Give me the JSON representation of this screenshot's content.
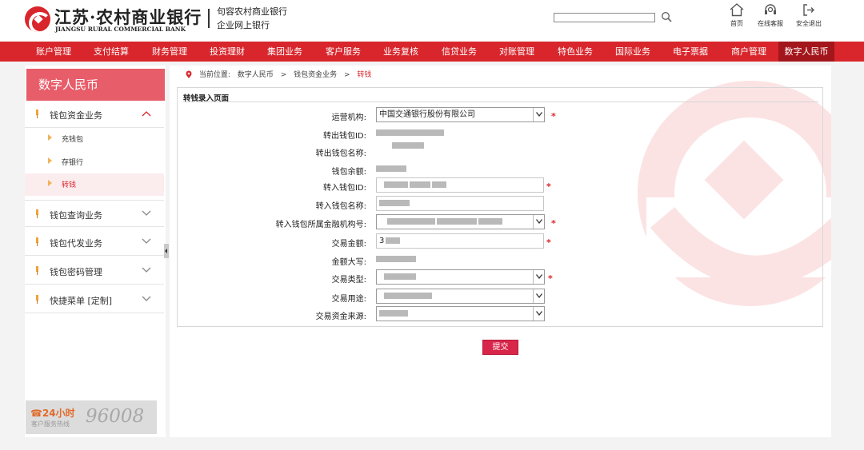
{
  "header": {
    "logo_cn": "江苏·农村商业银行",
    "logo_en": "JIANGSU RURAL COMMERCIAL BANK",
    "bank_name": "句容农村商业银行",
    "bank_sub": "企业网上银行",
    "search_placeholder": "",
    "links": [
      {
        "label": "首页",
        "icon": "home-icon"
      },
      {
        "label": "在线客服",
        "icon": "headset-icon"
      },
      {
        "label": "安全退出",
        "icon": "logout-icon"
      }
    ]
  },
  "nav": {
    "items": [
      "账户管理",
      "支付结算",
      "财务管理",
      "投资理财",
      "集团业务",
      "客户服务",
      "业务复核",
      "信贷业务",
      "对账管理",
      "特色业务",
      "国际业务",
      "电子票据",
      "商户管理",
      "数字人民币"
    ],
    "active_index": 13
  },
  "sidebar": {
    "title": "数字人民币",
    "groups": [
      {
        "label": "钱包资金业务",
        "expanded": true
      },
      {
        "label": "钱包查询业务",
        "expanded": false
      },
      {
        "label": "钱包代发业务",
        "expanded": false
      },
      {
        "label": "钱包密码管理",
        "expanded": false
      },
      {
        "label": "快捷菜单 [定制]",
        "expanded": false
      }
    ],
    "subitems": [
      {
        "label": "充钱包",
        "active": false
      },
      {
        "label": "存银行",
        "active": false
      },
      {
        "label": "转钱",
        "active": true
      }
    ],
    "hotline": {
      "label": "24小时",
      "sub": "客户服务热线",
      "number": "96008"
    }
  },
  "breadcrumb": {
    "prefix": "当前位置:",
    "items": [
      "数字人民币",
      "钱包资金业务"
    ],
    "current": "转钱"
  },
  "form": {
    "title": "转钱录入页面",
    "fields": {
      "org": {
        "label": "运营机构:",
        "value": "中国交通银行股份有限公司",
        "required": true
      },
      "out_id": {
        "label": "转出钱包ID:",
        "value": ""
      },
      "out_name": {
        "label": "转出钱包名称:",
        "value": ""
      },
      "balance": {
        "label": "钱包余额:",
        "value": ""
      },
      "in_id": {
        "label": "转入钱包ID:",
        "value": "",
        "required": true
      },
      "in_name": {
        "label": "转入钱包名称:",
        "value": ""
      },
      "in_org": {
        "label": "转入钱包所属金融机构号:",
        "value": "",
        "required": true
      },
      "amount": {
        "label": "交易金额:",
        "value": "3",
        "required": true
      },
      "amount_cn": {
        "label": "金额大写:",
        "value": ""
      },
      "type": {
        "label": "交易类型:",
        "value": "",
        "required": true
      },
      "purpose": {
        "label": "交易用途:",
        "value": ""
      },
      "source": {
        "label": "交易资金来源:",
        "value": ""
      }
    },
    "required_mark": "*",
    "submit_label": "提交"
  },
  "colors": {
    "brand_red": "#d8262c",
    "nav_active": "#a3161b",
    "sidebar_title": "#e85d6a",
    "submit": "#d8264a"
  }
}
